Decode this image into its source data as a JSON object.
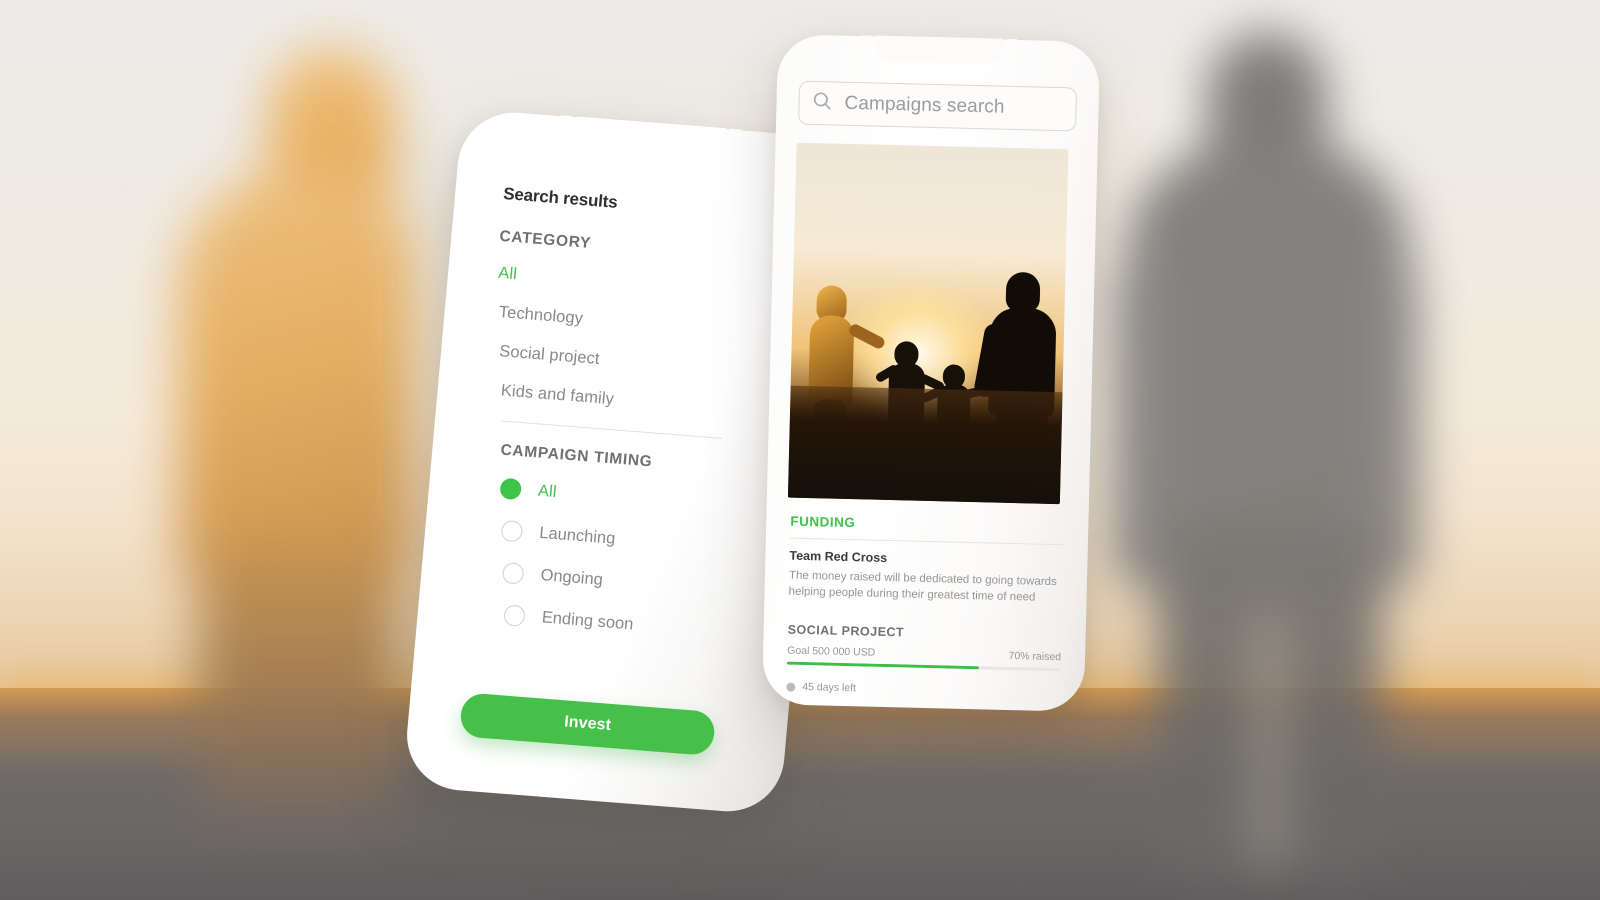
{
  "background": {
    "scene": "blurred-sunset-family-silhouettes",
    "sky_color": "#eeeae4",
    "ground_color": "#6a6766",
    "horizon_glow": "#ecaa48"
  },
  "theme": {
    "accent_green": "#3fc349",
    "button_green": "#47c04a",
    "text_dark": "#2f3033",
    "text_muted": "#86888b",
    "text_section": "#6e7073"
  },
  "left_phone": {
    "device": "smartphone-with-notch",
    "title": "Search results",
    "category": {
      "heading": "CATEGORY",
      "items": [
        {
          "label": "All",
          "selected": true
        },
        {
          "label": "Technology",
          "selected": false
        },
        {
          "label": "Social project",
          "selected": false
        },
        {
          "label": "Kids and family",
          "selected": false
        }
      ]
    },
    "campaign_timing": {
      "heading": "CAMPAIGN TIMING",
      "options": [
        {
          "label": "All",
          "selected": true
        },
        {
          "label": "Launching",
          "selected": false
        },
        {
          "label": "Ongoing",
          "selected": false
        },
        {
          "label": "Ending soon",
          "selected": false
        }
      ]
    },
    "primary_action": "Invest"
  },
  "right_phone": {
    "device": "smartphone-with-notch",
    "search": {
      "icon": "search-icon",
      "placeholder": "Campaigns search",
      "value": ""
    },
    "hero_image": {
      "alt": "Silhouette of a family of four holding hands at sunset"
    },
    "campaign": {
      "status_label": "FUNDING",
      "title": "Team Red Cross",
      "description": "The money raised will be dedicated to going towards helping people during their greatest time of need",
      "category_label": "SOCIAL PROJECT",
      "goal_text": "Goal 500 000 USD",
      "raised_text": "70% raised",
      "progress_percent": 70,
      "days_left_text": "45 days left"
    }
  }
}
